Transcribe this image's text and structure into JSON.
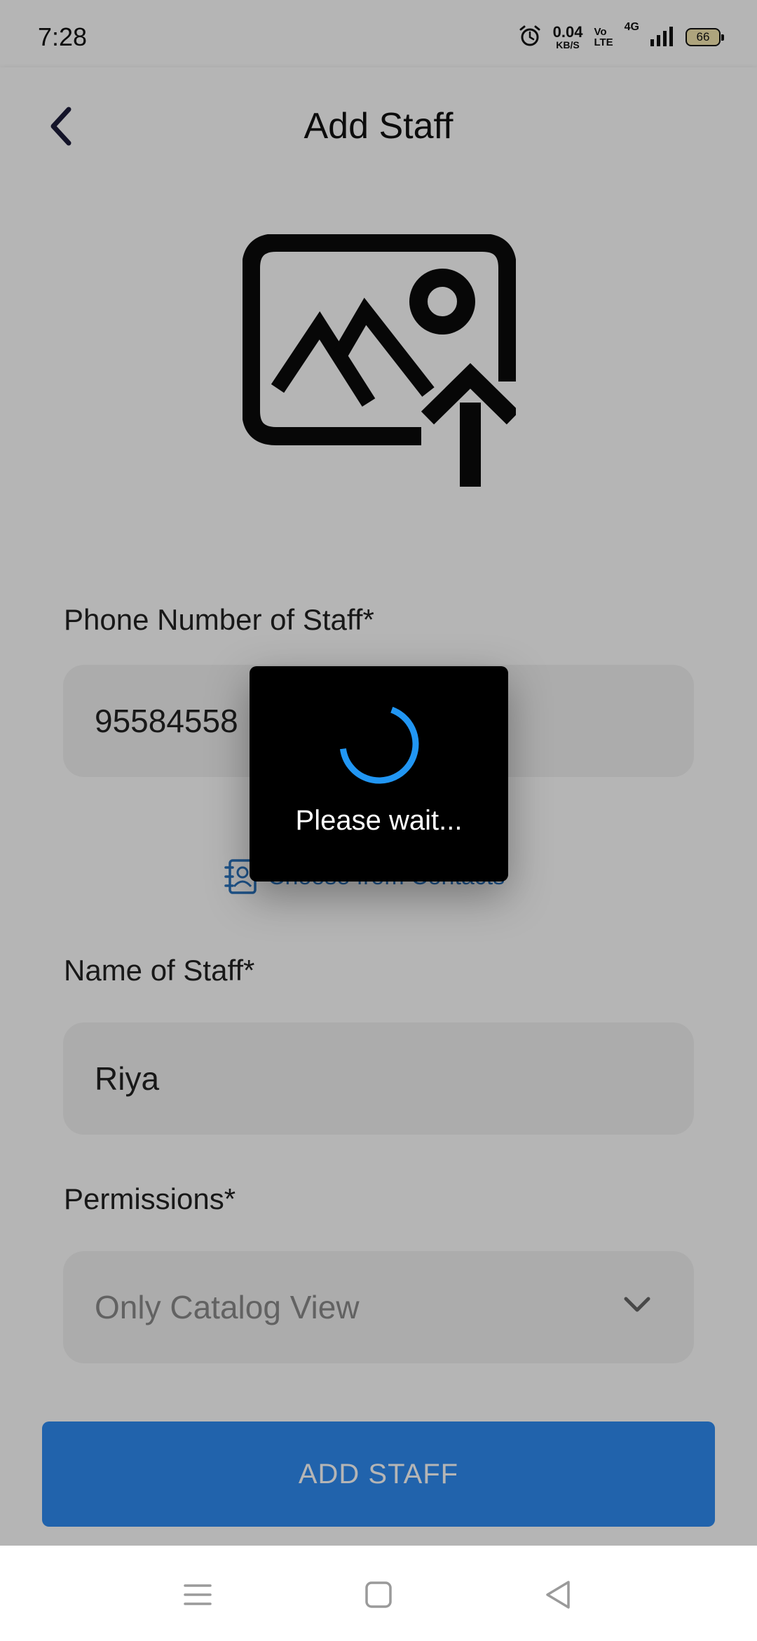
{
  "status_bar": {
    "time": "7:28",
    "net_speed_value": "0.04",
    "net_speed_unit": "KB/S",
    "volte_top": "Vo",
    "volte_bottom": "LTE",
    "network_type": "4G",
    "battery": "66"
  },
  "header": {
    "title": "Add Staff"
  },
  "form": {
    "phone_label": "Phone Number of Staff*",
    "phone_value": "95584558",
    "choose_contacts": "Choose from Contacts",
    "name_label": "Name of Staff*",
    "name_value": "Riya",
    "permissions_label": "Permissions*",
    "permissions_value": "Only Catalog View",
    "submit_label": "ADD STAFF"
  },
  "dialog": {
    "message": "Please wait..."
  },
  "colors": {
    "accent": "#2f8cf2",
    "spinner": "#2196f3",
    "dialog_bg": "#000000"
  },
  "icons": {
    "back": "chevron-left-icon",
    "upload": "image-upload-icon",
    "contacts": "contact-book-icon",
    "dropdown": "chevron-down-icon",
    "nav_menu": "menu-icon",
    "nav_home": "square-icon",
    "nav_back": "triangle-back-icon"
  }
}
